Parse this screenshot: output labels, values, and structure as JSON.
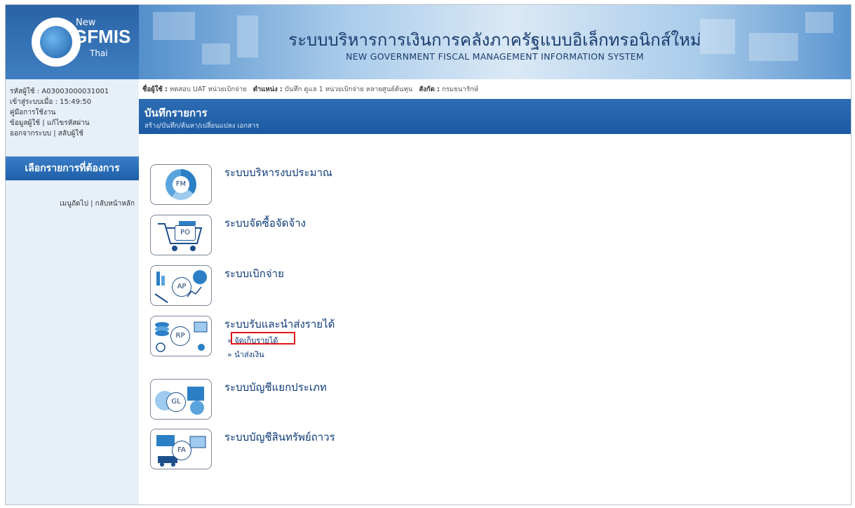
{
  "header": {
    "logo": {
      "new": "New",
      "name": "GFMIS",
      "thai": "Thai"
    },
    "title_th": "ระบบบริหารการเงินการคลังภาครัฐแบบอิเล็กทรอนิกส์ใหม่",
    "title_en": "NEW GOVERNMENT FISCAL MANAGEMENT INFORMATION SYSTEM"
  },
  "sidebar": {
    "user_code": "รหัสผู้ใช้ : A03003000031001",
    "login_time": "เข้าสู่ระบบเมื่อ : 15:49:50",
    "manual": "คู่มือการใช้งาน",
    "profile": "ข้อมูลผู้ใช้",
    "change_password": "แก้ไขรหัสผ่าน",
    "logout": "ออกจากระบบ",
    "switch_user": "สลับผู้ใช้",
    "menu_title": "เลือกรายการที่ต้องการ",
    "menu_sub": "เมนูถัดไป | กลับหน้าหลัก"
  },
  "breadcrumb": {
    "user_label": "ชื่อผู้ใช้ :",
    "user_value": "ทดสอบ UAT หน่วยเบิกจ่าย",
    "position_label": "ตำแหน่ง :",
    "position_value": "บันทึก ดูแล 1 หน่วยเบิกจ่าย หลายศูนย์ต้นทุน",
    "dept_label": "สังกัด :",
    "dept_value": "กรมธนารักษ์"
  },
  "page": {
    "title": "บันทึกรายการ",
    "subtitle": "สร้าง/บันทึก/ค้นหา/เปลี่ยนแปลง เอกสาร"
  },
  "modules": [
    {
      "code": "FM",
      "label": "ระบบบริหารงบประมาณ",
      "icon": "fm-icon"
    },
    {
      "code": "PO",
      "label": "ระบบจัดซื้อจัดจ้าง",
      "icon": "po-cart-icon"
    },
    {
      "code": "AP",
      "label": "ระบบเบิกจ่าย",
      "icon": "ap-chart-icon"
    },
    {
      "code": "RP",
      "label": "ระบบรับและนำส่งรายได้",
      "icon": "rp-coins-icon",
      "links": [
        "» จัดเก็บรายได้",
        "» นำส่งเงิน"
      ]
    },
    {
      "code": "GL",
      "label": "ระบบบัญชีแยกประเภท",
      "icon": "gl-icon"
    },
    {
      "code": "FA",
      "label": "ระบบบัญชีสินทรัพย์ถาวร",
      "icon": "fa-icon"
    }
  ],
  "colors": {
    "header_blue": "#2f6cae",
    "bar_blue": "#1b5aa2",
    "link_blue": "#0e3a78",
    "highlight_red": "#e0161c"
  }
}
